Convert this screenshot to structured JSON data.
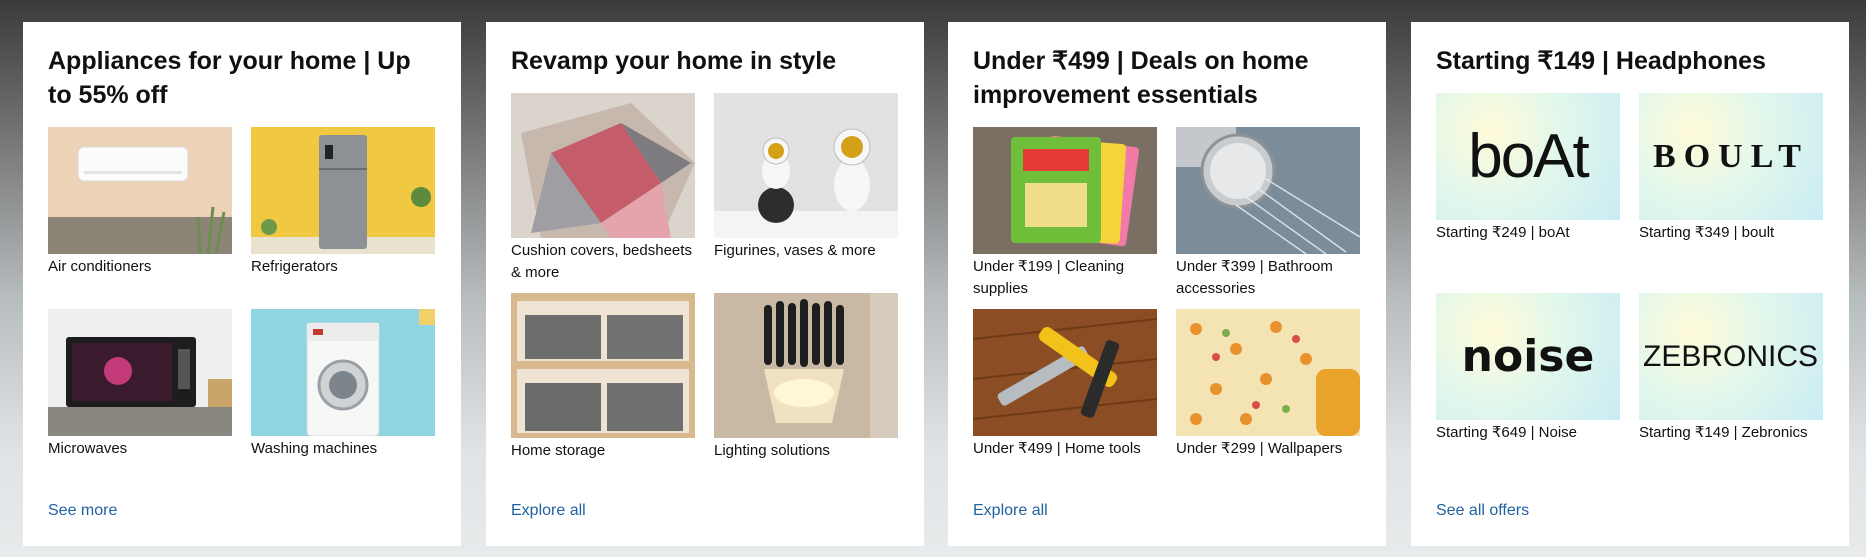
{
  "cards": [
    {
      "title": "Appliances for your home | Up to 55% off",
      "link": "See more",
      "tiles": [
        {
          "label": "Air conditioners",
          "icon": "air-conditioner-icon"
        },
        {
          "label": "Refrigerators",
          "icon": "refrigerator-icon"
        },
        {
          "label": "Microwaves",
          "icon": "microwave-icon"
        },
        {
          "label": "Washing machines",
          "icon": "washing-machine-icon"
        }
      ]
    },
    {
      "title": "Revamp your home in style",
      "link": "Explore all",
      "tiles": [
        {
          "label": "Cushion covers, bedsheets & more",
          "icon": "rug-icon"
        },
        {
          "label": "Figurines, vases & more",
          "icon": "figurine-icon"
        },
        {
          "label": "Home storage",
          "icon": "storage-icon"
        },
        {
          "label": "Lighting solutions",
          "icon": "lamp-icon"
        }
      ]
    },
    {
      "title": "Under ₹499 | Deals on home improvement essentials",
      "link": "Explore all",
      "tiles": [
        {
          "label": "Under ₹199 | Cleaning supplies",
          "icon": "sponge-icon"
        },
        {
          "label": "Under ₹399 | Bathroom accessories",
          "icon": "shower-icon"
        },
        {
          "label": "Under ₹499 | Home tools",
          "icon": "tools-icon"
        },
        {
          "label": "Under ₹299 | Wallpapers",
          "icon": "wallpaper-icon"
        }
      ]
    },
    {
      "title": "Starting ₹149 | Headphones",
      "link": "See all offers",
      "tiles": [
        {
          "label": "Starting ₹249 | boAt",
          "logo": "boAt",
          "icon": "boat-logo"
        },
        {
          "label": "Starting ₹349 | boult",
          "logo": "BOULT",
          "icon": "boult-logo"
        },
        {
          "label": "Starting ₹649 | Noise",
          "logo": "noise",
          "icon": "noise-logo"
        },
        {
          "label": "Starting ₹149 | Zebronics",
          "logo": "ZEBRONICS",
          "icon": "zebronics-logo"
        }
      ]
    }
  ],
  "colors": {
    "link": "#2162a1",
    "text": "#0f1111",
    "boat_accent": "#e31e24"
  }
}
